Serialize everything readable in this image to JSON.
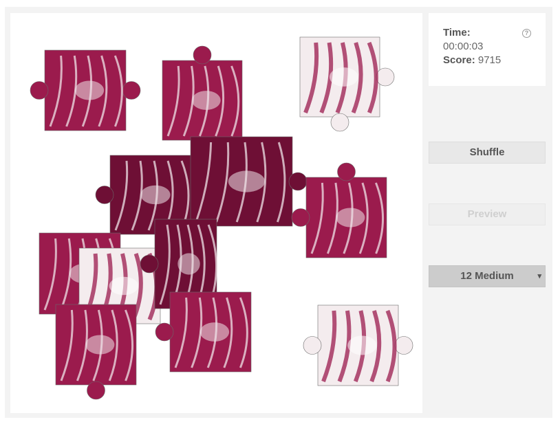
{
  "info": {
    "time_label": "Time:",
    "time_value": "00:00:03",
    "score_label": "Score:",
    "score_value": "9715",
    "help_icon": "?"
  },
  "controls": {
    "shuffle_label": "Shuffle",
    "preview_label": "Preview",
    "difficulty_label": "12 Medium",
    "difficulty_caret": "▾"
  },
  "puzzle": {
    "piece_count": 12,
    "colors": {
      "magenta": "#9b1b4d",
      "deep": "#6e0f35",
      "light": "#f4ecee",
      "rib": "#efe3e7"
    }
  }
}
